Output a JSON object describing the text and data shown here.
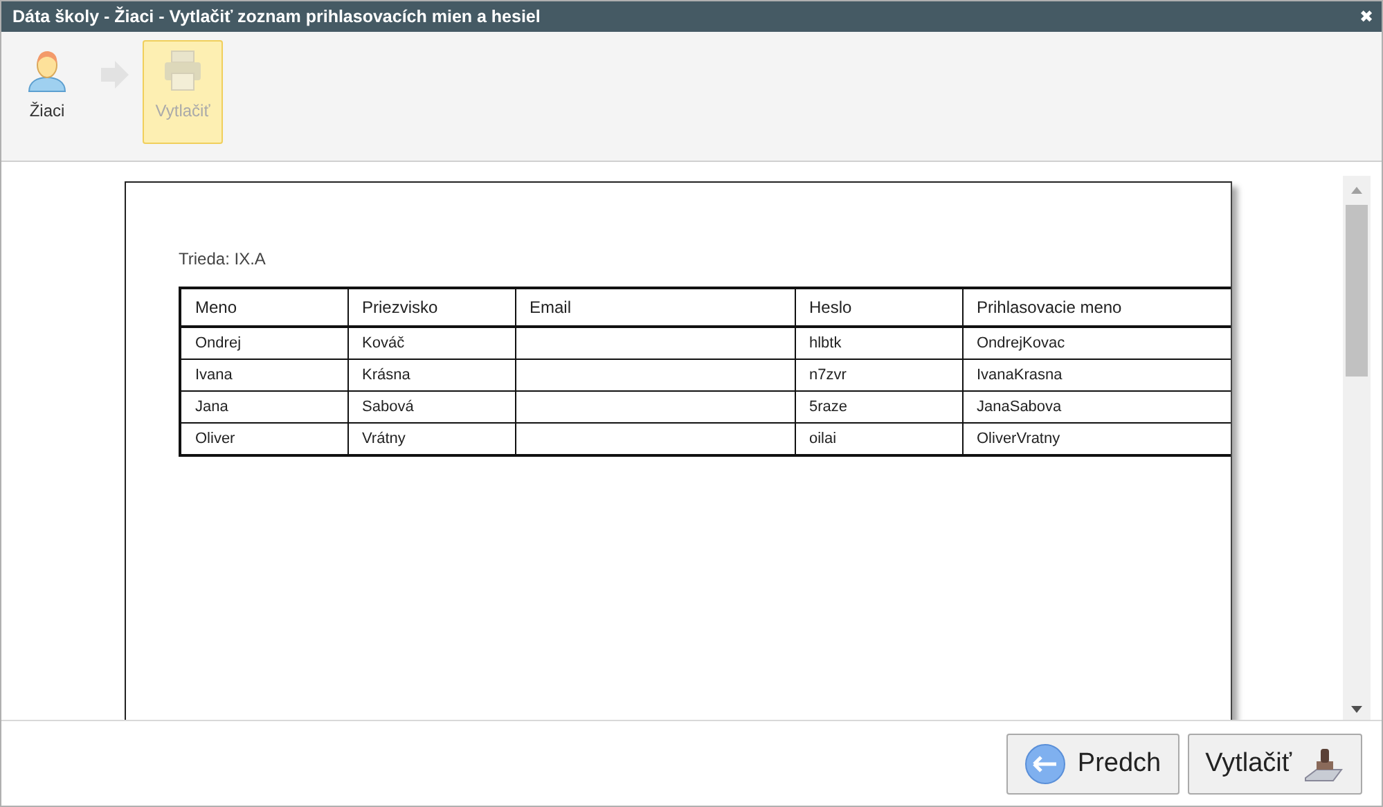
{
  "window": {
    "title": "Dáta školy - Žiaci - Vytlačiť zoznam prihlasovacích mien a hesiel",
    "close": "✖"
  },
  "toolbar": [
    {
      "kind": "person",
      "label": "Žiaci",
      "selected": false,
      "disabled": false
    },
    {
      "kind": "print",
      "label": "Vytlačiť",
      "selected": true,
      "disabled": true
    }
  ],
  "document": {
    "class_label": "Trieda: IX.A",
    "table": {
      "columns": [
        "Meno",
        "Priezvisko",
        "Email",
        "Heslo",
        "Prihlasovacie meno"
      ],
      "rows": [
        [
          "Ondrej",
          "Kováč",
          "",
          "hlbtk",
          "OndrejKovac"
        ],
        [
          "Ivana",
          "Krásna",
          "",
          "n7zvr",
          "IvanaKrasna"
        ],
        [
          "Jana",
          "Sabová",
          "",
          "5raze",
          "JanaSabova"
        ],
        [
          "Oliver",
          "Vrátny",
          "",
          "oilai",
          "OliverVratny"
        ]
      ]
    }
  },
  "buttons": [
    {
      "kind": "back",
      "label": "Predch"
    },
    {
      "kind": "print",
      "label": "Vytlačiť"
    }
  ]
}
